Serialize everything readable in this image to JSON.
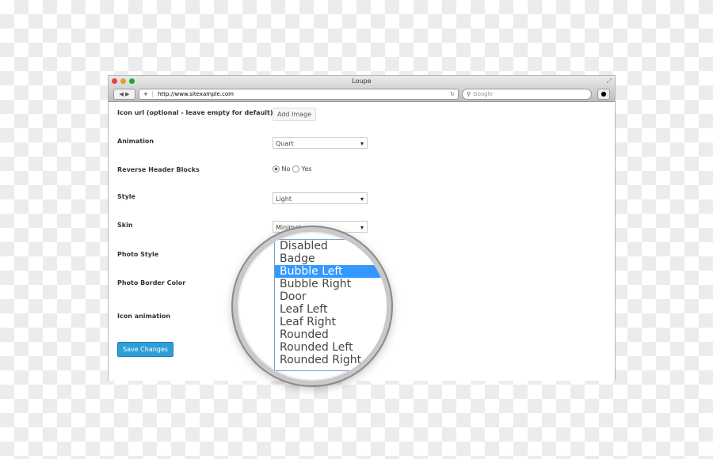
{
  "window": {
    "title": "Loupe",
    "url": "http://www.sitexample.com",
    "search_placeholder": "Google"
  },
  "form": {
    "icon_url_label": "Icon url (optional - leave empty for default)",
    "add_image": "Add Image",
    "animation_label": "Animation",
    "animation_value": "Quart",
    "reverse_label": "Reverse Header Blocks",
    "no": "No",
    "yes": "Yes",
    "reverse_selected": "No",
    "style_label": "Style",
    "style_value": "Light",
    "skin_label": "Skin",
    "skin_value": "Minimal",
    "photo_style_label": "Photo Style",
    "photo_border_label": "Photo Border Color",
    "icon_animation_label": "Icon animation",
    "save": "Save Changes"
  },
  "dropdown": {
    "items": [
      "Disabled",
      "Badge",
      "Bubble Left",
      "Bubble Right",
      "Door",
      "Leaf Left",
      "Leaf Right",
      "Rounded",
      "Rounded Left",
      "Rounded Right"
    ],
    "selected": "Bubble Left",
    "highlight_color": "#3399ff"
  }
}
